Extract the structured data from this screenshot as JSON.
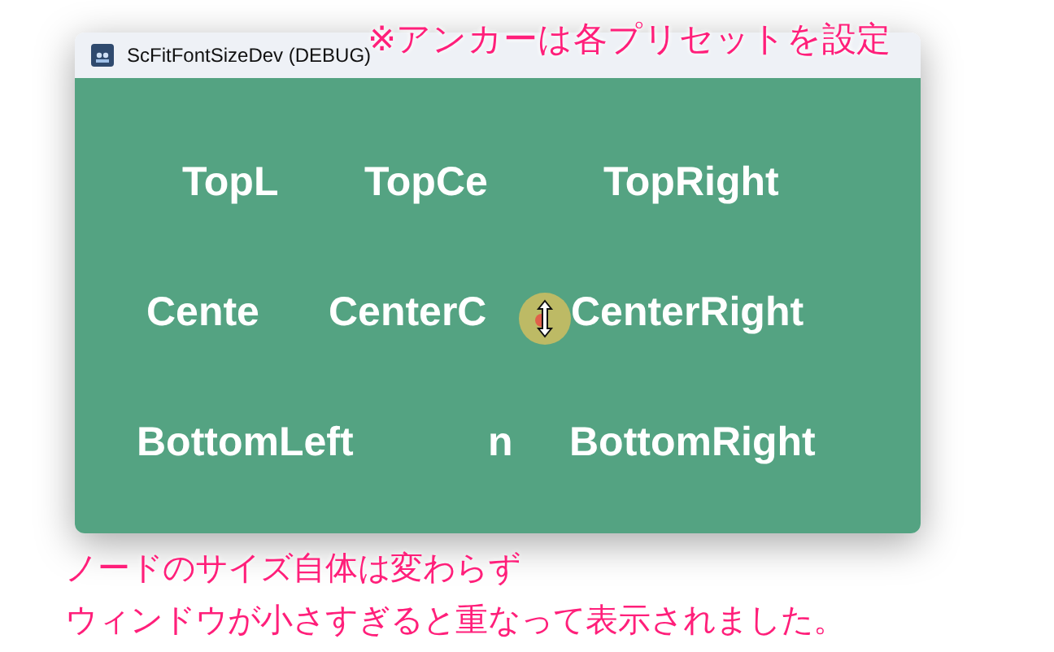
{
  "window": {
    "title": "ScFitFontSizeDev (DEBUG)"
  },
  "label_rows": [
    [
      "TopL",
      "TopCe",
      "TopRight"
    ],
    [
      "Cente",
      "CenterC",
      "CenterRight"
    ],
    [
      "BottomLeft",
      "n",
      "BottomRight"
    ]
  ],
  "top_note": "※アンカーは各プリセットを設定",
  "bottom_notes": [
    "ノードのサイズ自体は変わらず",
    "ウィンドウが小さすぎると重なって表示されました。"
  ]
}
